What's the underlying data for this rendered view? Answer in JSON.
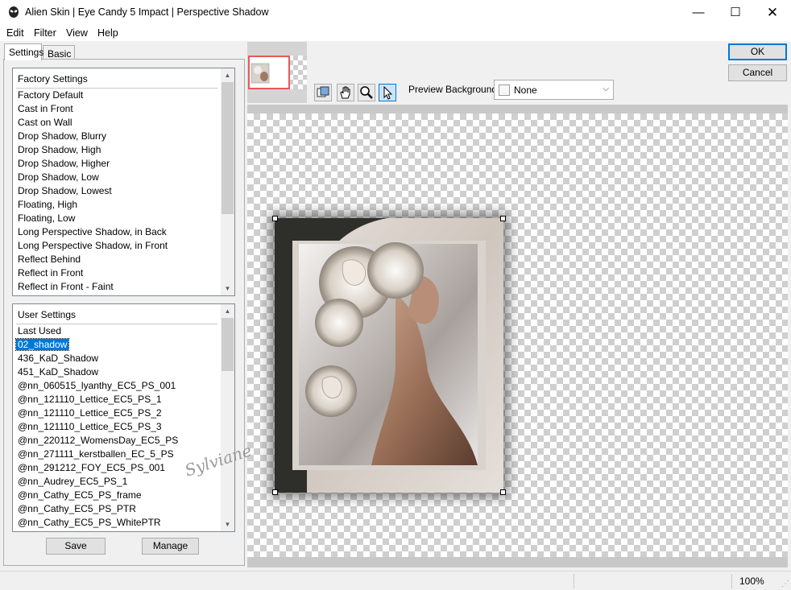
{
  "window": {
    "title": "Alien Skin | Eye Candy 5 Impact | Perspective Shadow",
    "min_glyph": "—",
    "max_glyph": "☐",
    "close_glyph": "✕"
  },
  "menu": [
    "Edit",
    "Filter",
    "View",
    "Help"
  ],
  "tabs": {
    "settings": "Settings",
    "basic": "Basic"
  },
  "factory": {
    "header": "Factory Settings",
    "items": [
      "Factory Default",
      "Cast in Front",
      "Cast on Wall",
      "Drop Shadow, Blurry",
      "Drop Shadow, High",
      "Drop Shadow, Higher",
      "Drop Shadow, Low",
      "Drop Shadow, Lowest",
      "Floating, High",
      "Floating, Low",
      "Long Perspective Shadow, in Back",
      "Long Perspective Shadow, in Front",
      "Reflect Behind",
      "Reflect in Front",
      "Reflect in Front - Faint"
    ]
  },
  "user": {
    "header": "User Settings",
    "selected": "02_shadow",
    "items": [
      "Last Used",
      "02_shadow",
      "436_KaD_Shadow",
      "451_KaD_Shadow",
      "@nn_060515_lyanthy_EC5_PS_001",
      "@nn_121110_Lettice_EC5_PS_1",
      "@nn_121110_Lettice_EC5_PS_2",
      "@nn_121110_Lettice_EC5_PS_3",
      "@nn_220112_WomensDay_EC5_PS",
      "@nn_271111_kerstballen_EC_5_PS",
      "@nn_291212_FOY_EC5_PS_001",
      "@nn_Audrey_EC5_PS_1",
      "@nn_Cathy_EC5_PS_frame",
      "@nn_Cathy_EC5_PS_PTR",
      "@nn_Cathy_EC5_PS_WhitePTR"
    ]
  },
  "buttons": {
    "save": "Save",
    "manage": "Manage",
    "ok": "OK",
    "cancel": "Cancel"
  },
  "preview_background": {
    "label": "Preview Background:",
    "value": "None"
  },
  "tools": [
    "preview-toggle-icon",
    "hand-icon",
    "zoom-icon",
    "arrow-pointer-icon"
  ],
  "status": {
    "zoom": "100%"
  },
  "watermark": "Sylviane",
  "colors": {
    "selection": "#0078d7",
    "ok_border": "#0078d7",
    "thumb_border": "#e8585a"
  }
}
